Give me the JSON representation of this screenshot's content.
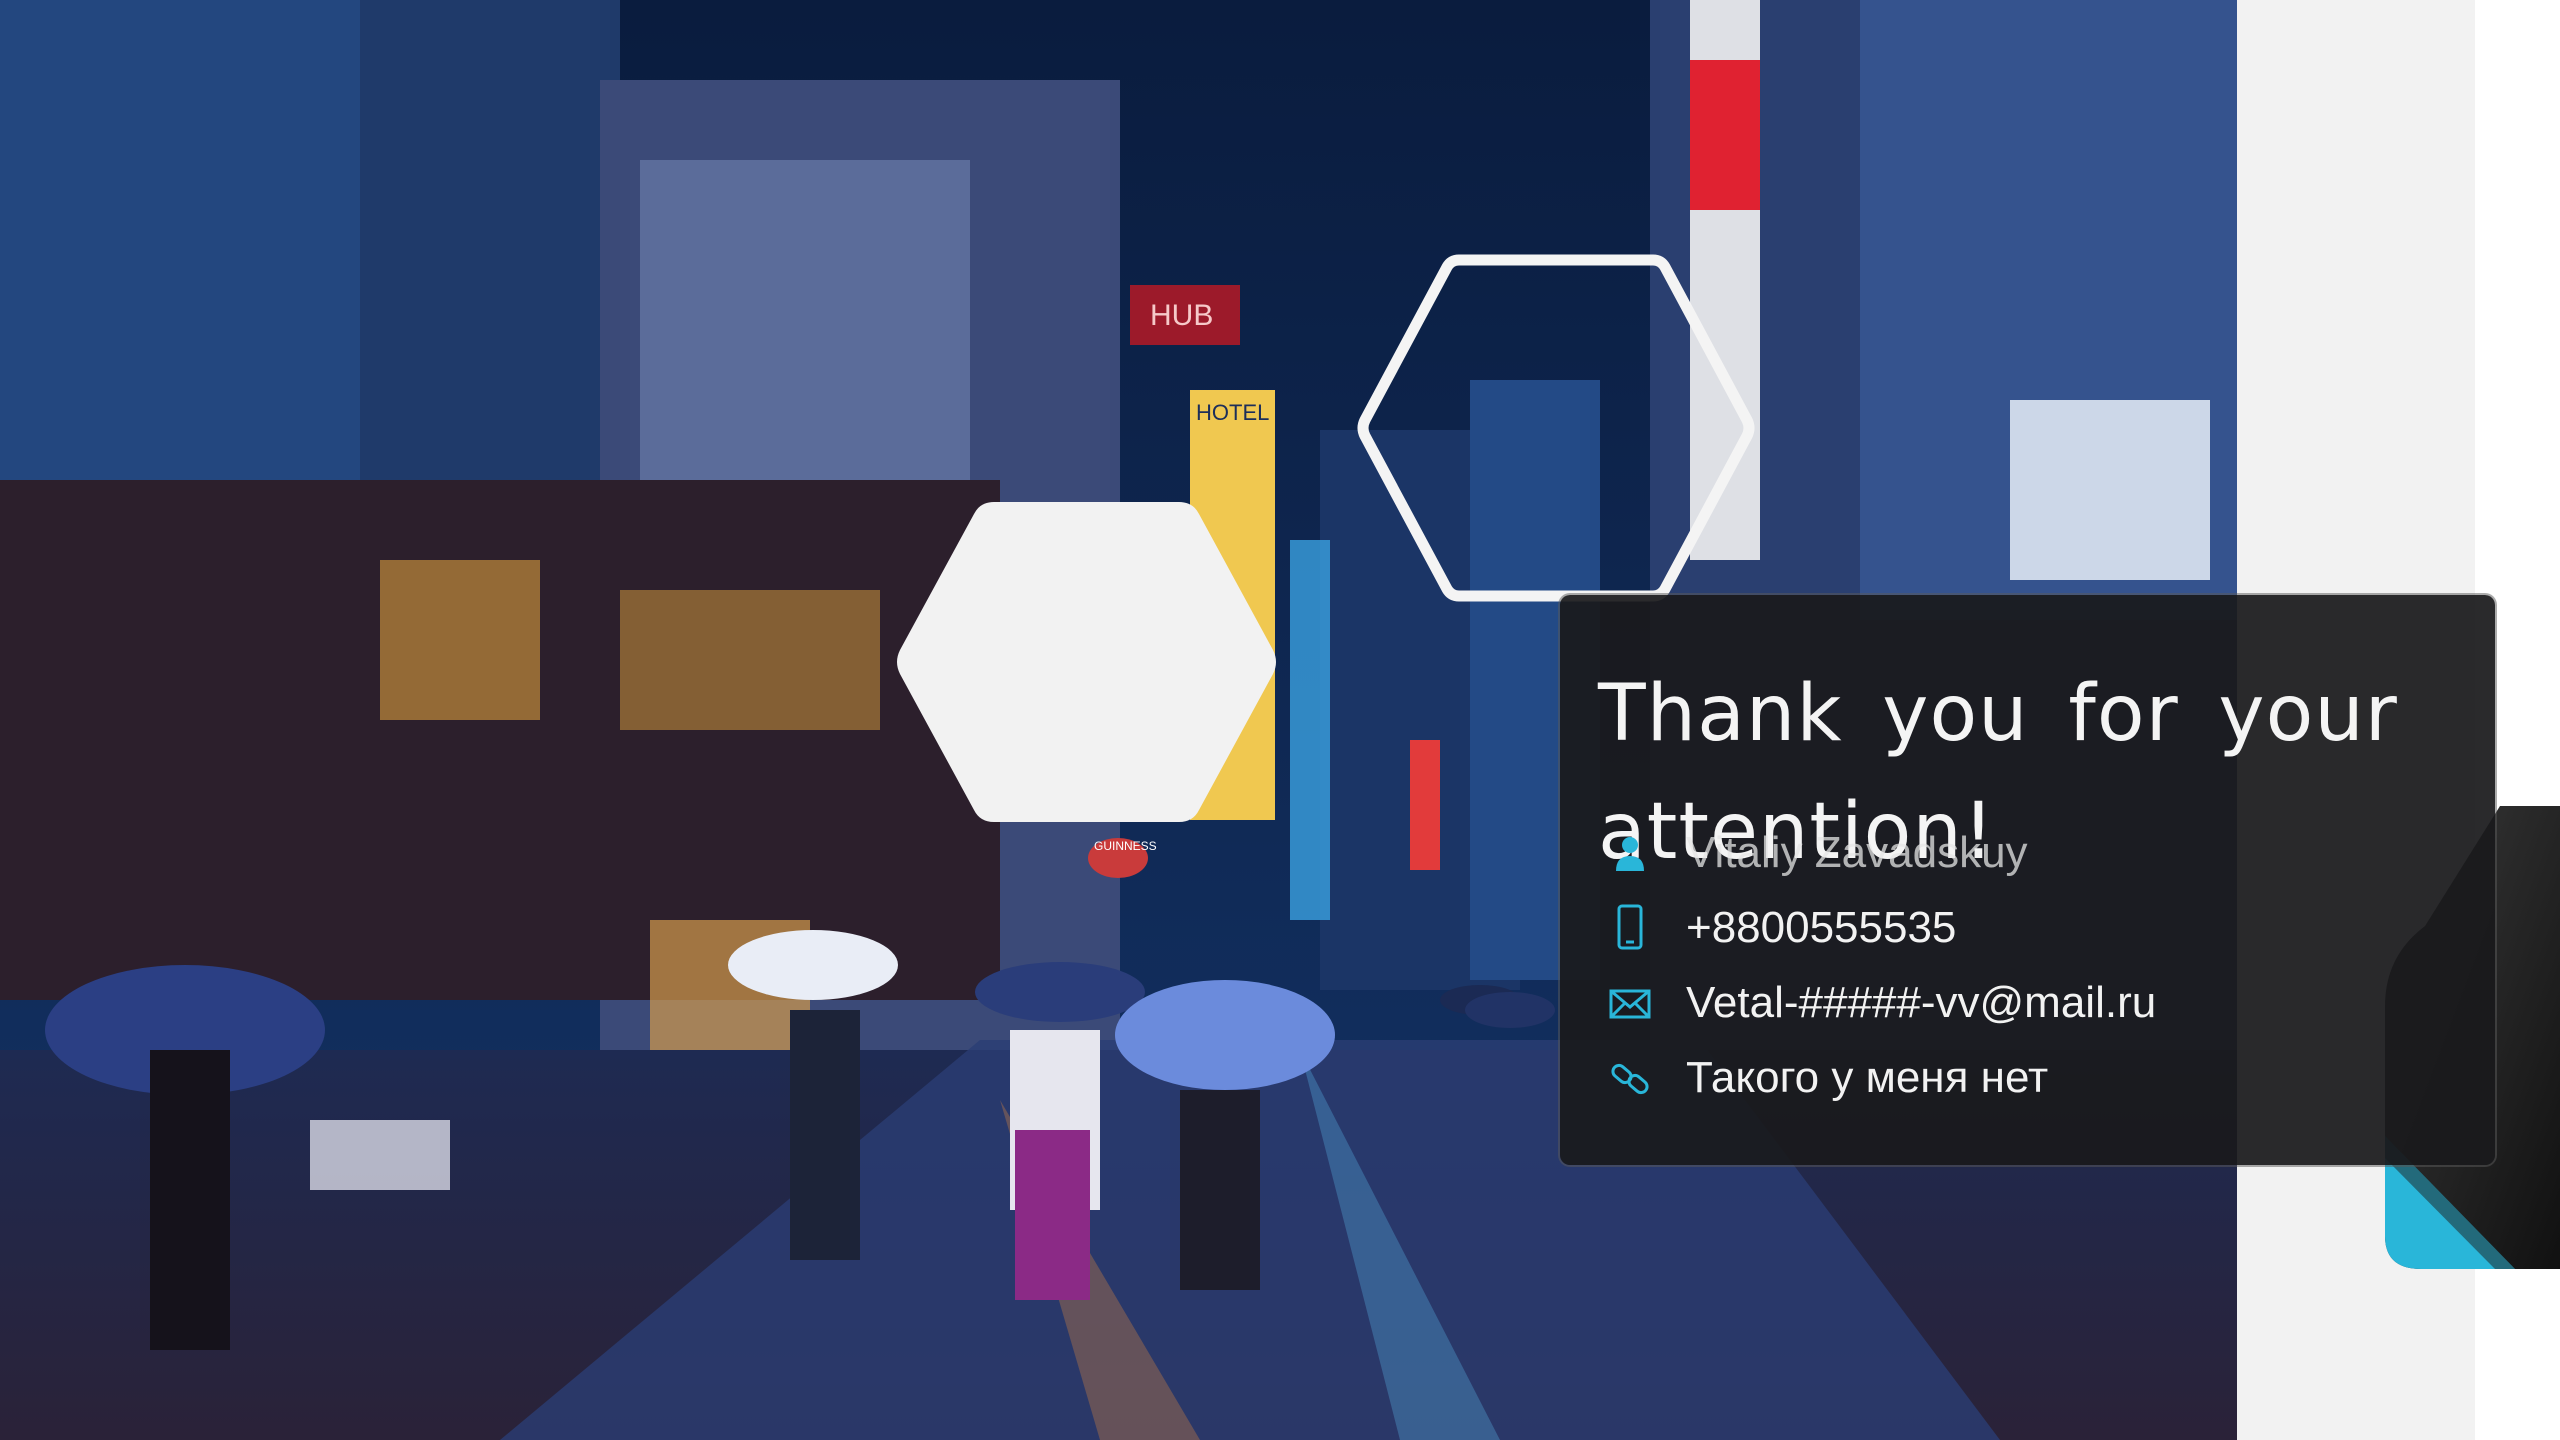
{
  "slide": {
    "title": "Thank you for your attention!",
    "contacts": [
      {
        "icon": "person-icon",
        "text": "Vitaliy Zavadskuy"
      },
      {
        "icon": "phone-icon",
        "text": "+8800555535"
      },
      {
        "icon": "mail-icon",
        "text": "Vetal-#####-vv@mail.ru"
      },
      {
        "icon": "link-icon",
        "text": "Такого у меня нет"
      }
    ],
    "photo_signs": {
      "hub": "HUB",
      "hotel": "HOTEL",
      "guinness": "GUINNESS"
    }
  },
  "colors": {
    "accent": "#29b6d9",
    "card": "#1a1a1c",
    "hexagon": "#f2f2f2",
    "side_panel": "#f2f2f2"
  }
}
